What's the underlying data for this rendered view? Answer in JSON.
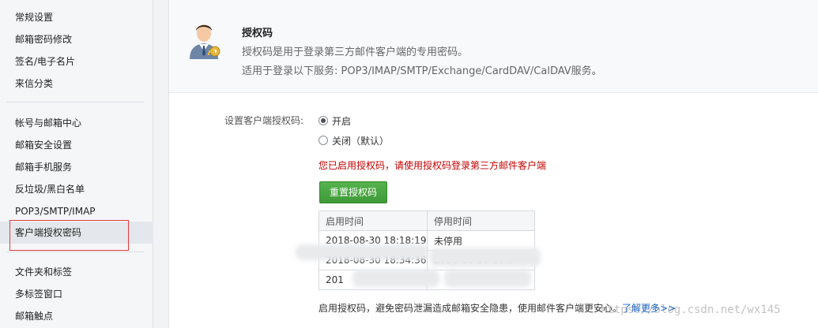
{
  "sidebar": {
    "group1": [
      "常规设置",
      "邮箱密码修改",
      "签名/电子名片",
      "来信分类"
    ],
    "group2": [
      "帐号与邮箱中心",
      "邮箱安全设置",
      "邮箱手机服务",
      "反垃圾/黑白名单",
      "POP3/SMTP/IMAP",
      "客户端授权密码"
    ],
    "group3": [
      "文件夹和标签",
      "多标签窗口",
      "邮箱触点"
    ],
    "active_item": "客户端授权密码"
  },
  "header": {
    "title": "授权码",
    "line1": "授权码是用于登录第三方邮件客户端的专用密码。",
    "line2": "适用于登录以下服务: POP3/IMAP/SMTP/Exchange/CardDAV/CalDAV服务。"
  },
  "settings": {
    "label": "设置客户端授权码:",
    "option_on": "开启",
    "option_off": "关闭（默认）",
    "selected": "on",
    "notice": "您已启用授权码，请使用授权码登录第三方邮件客户端",
    "reset_button": "重置授权码"
  },
  "table": {
    "headers": [
      "启用时间",
      "停用时间"
    ],
    "rows": [
      [
        "2018-08-30 18:18:19",
        "未停用"
      ],
      [
        "2018-08-30 18:34:36",
        "2018-08-30 18:3"
      ],
      [
        "201",
        ""
      ]
    ]
  },
  "footer": {
    "text": "启用授权码，避免密码泄漏造成邮箱安全隐患，使用邮件客户端更安心。",
    "link": "了解更多>>"
  },
  "watermark": "https://blog.csdn.net/wx145",
  "colors": {
    "accent_green": "#45a13e",
    "notice_red": "#c40000",
    "link_blue": "#1b66c7",
    "highlight_box": "#e33a3a"
  },
  "icons": {
    "header_avatar": "user-key-icon"
  }
}
